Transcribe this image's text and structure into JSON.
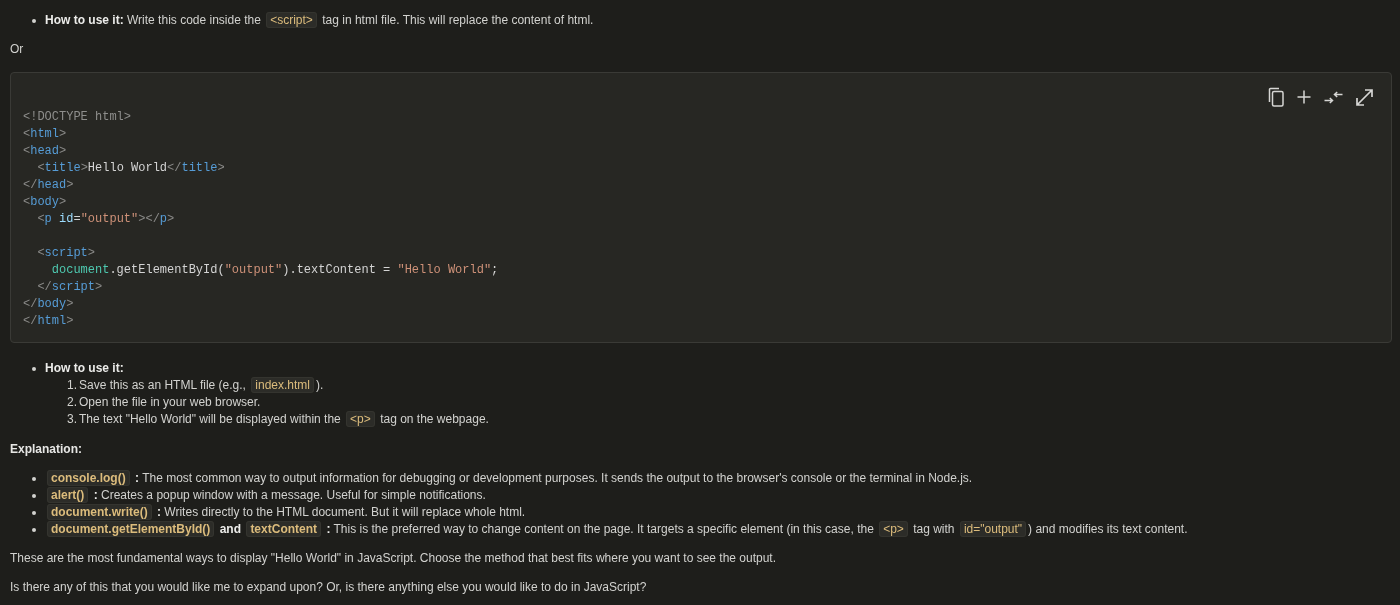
{
  "blocks": [
    {
      "kind": "bullets",
      "items": [
        {
          "parts": [
            {
              "kind": "bold",
              "text": "How to use it:"
            },
            {
              "kind": "text",
              "text": " Write this code inside the "
            },
            {
              "kind": "code",
              "text": "<script>"
            },
            {
              "kind": "text",
              "text": " tag in html file. This will replace the content of html."
            }
          ]
        }
      ]
    },
    {
      "kind": "paragraph",
      "parts": [
        {
          "kind": "text",
          "text": "Or"
        }
      ]
    },
    {
      "kind": "code",
      "lines": [
        {
          "kind": "code",
          "tokens": [
            {
              "kind": "meta",
              "text": "<!DOCTYPE html>"
            }
          ]
        },
        {
          "kind": "code",
          "tokens": [
            {
              "kind": "punct",
              "text": "<"
            },
            {
              "kind": "tag",
              "text": "html"
            },
            {
              "kind": "punct",
              "text": ">"
            }
          ]
        },
        {
          "kind": "code",
          "tokens": [
            {
              "kind": "punct",
              "text": "<"
            },
            {
              "kind": "tag",
              "text": "head"
            },
            {
              "kind": "punct",
              "text": ">"
            }
          ]
        },
        {
          "kind": "code",
          "tokens": [
            {
              "kind": "punct",
              "text": "  <"
            },
            {
              "kind": "tag",
              "text": "title"
            },
            {
              "kind": "punct",
              "text": ">"
            },
            {
              "kind": "plain",
              "text": "Hello World"
            },
            {
              "kind": "punct",
              "text": "</"
            },
            {
              "kind": "tag",
              "text": "title"
            },
            {
              "kind": "punct",
              "text": ">"
            }
          ]
        },
        {
          "kind": "code",
          "tokens": [
            {
              "kind": "punct",
              "text": "</"
            },
            {
              "kind": "tag",
              "text": "head"
            },
            {
              "kind": "punct",
              "text": ">"
            }
          ]
        },
        {
          "kind": "code",
          "tokens": [
            {
              "kind": "punct",
              "text": "<"
            },
            {
              "kind": "tag",
              "text": "body"
            },
            {
              "kind": "punct",
              "text": ">"
            }
          ]
        },
        {
          "kind": "code",
          "tokens": [
            {
              "kind": "punct",
              "text": "  <"
            },
            {
              "kind": "tag",
              "text": "p"
            },
            {
              "kind": "attr",
              "text": " id"
            },
            {
              "kind": "plain",
              "text": "="
            },
            {
              "kind": "string",
              "text": "\"output\""
            },
            {
              "kind": "punct",
              "text": "></"
            },
            {
              "kind": "tag",
              "text": "p"
            },
            {
              "kind": "punct",
              "text": ">"
            }
          ]
        },
        {
          "kind": "blank"
        },
        {
          "kind": "code",
          "tokens": [
            {
              "kind": "punct",
              "text": "  <"
            },
            {
              "kind": "tag",
              "text": "script"
            },
            {
              "kind": "punct",
              "text": ">"
            }
          ]
        },
        {
          "kind": "code",
          "tokens": [
            {
              "kind": "object",
              "text": "    document"
            },
            {
              "kind": "plain",
              "text": ".getElementById("
            },
            {
              "kind": "string",
              "text": "\"output\""
            },
            {
              "kind": "plain",
              "text": ").textContent = "
            },
            {
              "kind": "string",
              "text": "\"Hello World\""
            },
            {
              "kind": "plain",
              "text": ";"
            }
          ]
        },
        {
          "kind": "code",
          "tokens": [
            {
              "kind": "punct",
              "text": "  </"
            },
            {
              "kind": "tag",
              "text": "script"
            },
            {
              "kind": "punct",
              "text": ">"
            }
          ]
        },
        {
          "kind": "code",
          "tokens": [
            {
              "kind": "punct",
              "text": "</"
            },
            {
              "kind": "tag",
              "text": "body"
            },
            {
              "kind": "punct",
              "text": ">"
            }
          ]
        },
        {
          "kind": "code",
          "tokens": [
            {
              "kind": "punct",
              "text": "</"
            },
            {
              "kind": "tag",
              "text": "html"
            },
            {
              "kind": "punct",
              "text": ">"
            }
          ]
        }
      ]
    },
    {
      "kind": "bullets",
      "items": [
        {
          "parts": [
            {
              "kind": "bold",
              "text": "How to use it:"
            }
          ],
          "steps": [
            {
              "number": "1.",
              "parts": [
                {
                  "kind": "text",
                  "text": "Save this as an HTML file (e.g., "
                },
                {
                  "kind": "code",
                  "text": "index.html"
                },
                {
                  "kind": "text",
                  "text": ")."
                }
              ]
            },
            {
              "number": "2.",
              "parts": [
                {
                  "kind": "text",
                  "text": "Open the file in your web browser."
                }
              ]
            },
            {
              "number": "3.",
              "parts": [
                {
                  "kind": "text",
                  "text": "The text \"Hello World\" will be displayed within the "
                },
                {
                  "kind": "code",
                  "text": "<p>"
                },
                {
                  "kind": "text",
                  "text": " tag on the webpage."
                }
              ]
            }
          ]
        }
      ]
    },
    {
      "kind": "heading",
      "text": "Explanation:"
    },
    {
      "kind": "bullets",
      "items": [
        {
          "parts": [
            {
              "kind": "bold_code",
              "text": "console.log()"
            },
            {
              "kind": "bold",
              "text": " :"
            },
            {
              "kind": "text",
              "text": " The most common way to output information for debugging or development purposes. It sends the output to the browser's console or the terminal in Node.js."
            }
          ]
        },
        {
          "parts": [
            {
              "kind": "bold_code",
              "text": "alert()"
            },
            {
              "kind": "bold",
              "text": " :"
            },
            {
              "kind": "text",
              "text": " Creates a popup window with a message. Useful for simple notifications."
            }
          ]
        },
        {
          "parts": [
            {
              "kind": "bold_code",
              "text": "document.write()"
            },
            {
              "kind": "bold",
              "text": " :"
            },
            {
              "kind": "text",
              "text": " Writes directly to the HTML document. But it will replace whole html."
            }
          ]
        },
        {
          "parts": [
            {
              "kind": "bold_code",
              "text": "document.getElementById()"
            },
            {
              "kind": "bold",
              "text": " and "
            },
            {
              "kind": "bold_code",
              "text": "textContent"
            },
            {
              "kind": "bold",
              "text": " :"
            },
            {
              "kind": "text",
              "text": " This is the preferred way to change content on the page. It targets a specific element (in this case, the "
            },
            {
              "kind": "code",
              "text": "<p>"
            },
            {
              "kind": "text",
              "text": " tag with "
            },
            {
              "kind": "code",
              "text": "id=\"output\""
            },
            {
              "kind": "text",
              "text": ") and modifies its text content."
            }
          ]
        }
      ]
    },
    {
      "kind": "paragraph",
      "parts": [
        {
          "kind": "text",
          "text": "These are the most fundamental ways to display \"Hello World\" in JavaScript. Choose the method that best fits where you want to see the output."
        }
      ]
    },
    {
      "kind": "paragraph",
      "parts": [
        {
          "kind": "text",
          "text": "Is there any of this that you would like me to expand upon? Or, is there anything else you would like to do in JavaScript?"
        }
      ]
    }
  ]
}
